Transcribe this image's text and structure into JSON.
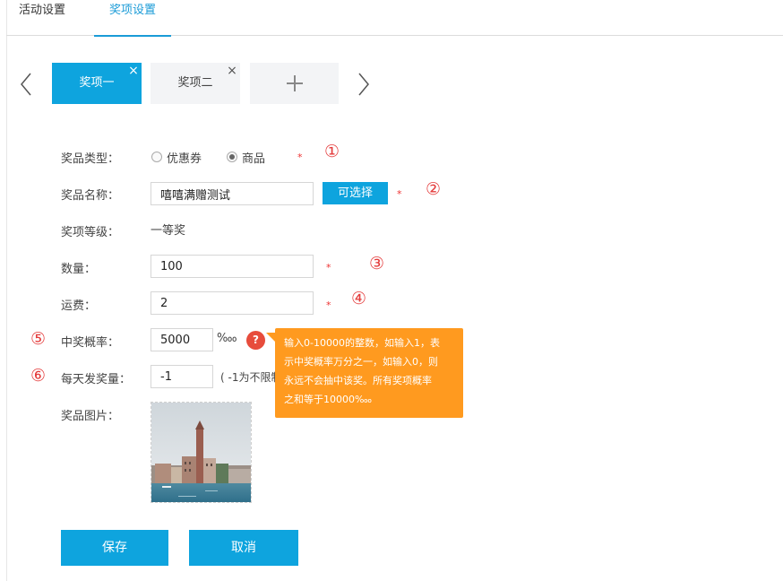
{
  "top_tabs": [
    {
      "label": "活动设置"
    },
    {
      "label": "奖项设置"
    }
  ],
  "prize_tabs": [
    {
      "label": "奖项一",
      "close": "×"
    },
    {
      "label": "奖项二",
      "close": "×"
    }
  ],
  "add_tab_icon": "plus-icon",
  "form": {
    "prize_type": {
      "label": "奖品类型：",
      "options": [
        "优惠券",
        "商品"
      ],
      "selected": "商品"
    },
    "prize_name": {
      "label": "奖品名称：",
      "value": "嘻嘻满赠测试",
      "button": "可选择"
    },
    "level": {
      "label": "奖项等级：",
      "value": "一等奖"
    },
    "quantity": {
      "label": "数量：",
      "value": "100"
    },
    "shipping": {
      "label": "运费：",
      "value": "2"
    },
    "probability": {
      "label": "中奖概率：",
      "value": "5000",
      "unit": "‱",
      "help": "?"
    },
    "daily": {
      "label": "每天发奖量：",
      "value": "-1",
      "hint": "( -1为不限制"
    },
    "image": {
      "label": "奖品图片："
    },
    "required_mark": "*"
  },
  "tooltip": {
    "lines": [
      "输入0-10000的整数，如输入1，表",
      "示中奖概率万分之一，如输入0，则",
      "永远不会抽中该奖。所有奖项概率",
      "之和等于10000‱"
    ]
  },
  "annotations": [
    "①",
    "②",
    "③",
    "④",
    "⑤",
    "⑥"
  ],
  "buttons": {
    "save": "保存",
    "cancel": "取消"
  },
  "colors": {
    "accent": "#0ea4de",
    "tooltip": "#ff9a1f",
    "required": "#e33333",
    "help": "#e74c3c"
  }
}
